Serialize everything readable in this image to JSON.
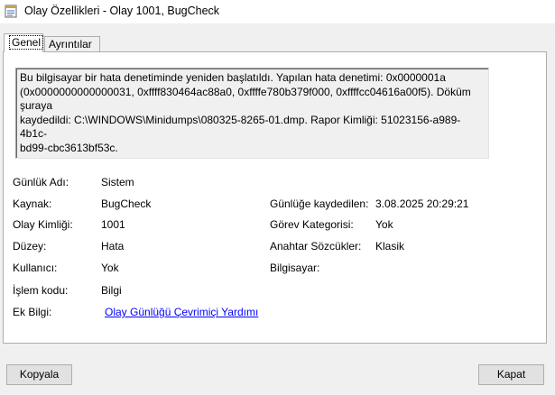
{
  "window": {
    "title": "Olay Özellikleri - Olay 1001, BugCheck"
  },
  "tabs": [
    {
      "label": "Genel",
      "selected": true
    },
    {
      "label": "Ayrıntılar",
      "selected": false
    }
  ],
  "description": "Bu bilgisayar bir hata denetiminde yeniden başlatıldı. Yapılan hata denetimi: 0x0000001a\n(0x0000000000000031, 0xffff830464ac88a0, 0xffffe780b379f000, 0xffffcc04616a00f5). Döküm şuraya\nkaydedildi: C:\\WINDOWS\\Minidumps\\080325-8265-01.dmp. Rapor Kimliği: 51023156-a989-4b1c-\nbd99-cbc3613bf53c.",
  "fields": {
    "log_name": {
      "label": "Günlük Adı:",
      "value": "Sistem"
    },
    "source": {
      "label": "Kaynak:",
      "value": "BugCheck"
    },
    "logged": {
      "label": "Günlüğe kaydedilen:",
      "value": "3.08.2025 20:29:21"
    },
    "event_id": {
      "label": "Olay Kimliği:",
      "value": "1001"
    },
    "task_category": {
      "label": "Görev Kategorisi:",
      "value": "Yok"
    },
    "level": {
      "label": "Düzey:",
      "value": "Hata"
    },
    "keywords": {
      "label": "Anahtar Sözcükler:",
      "value": "Klasik"
    },
    "user": {
      "label": "Kullanıcı:",
      "value": "Yok"
    },
    "computer": {
      "label": "Bilgisayar:",
      "value": ""
    },
    "opcode": {
      "label": "İşlem kodu:",
      "value": "Bilgi"
    },
    "more_info": {
      "label": "Ek Bilgi:",
      "link": "Olay Günlüğü Çevrimiçi Yardımı"
    }
  },
  "buttons": {
    "copy": "Kopyala",
    "close": "Kapat"
  },
  "colors": {
    "link": "#0000ff",
    "redaction": "#1e90ff"
  }
}
